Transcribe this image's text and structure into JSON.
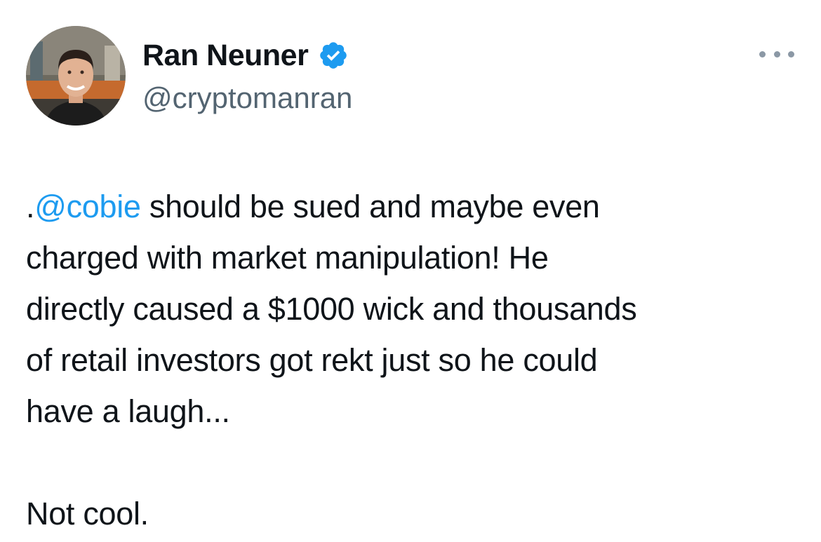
{
  "author": {
    "display_name": "Ran Neuner",
    "handle": "@cryptomanran",
    "verified_icon": "verified-badge-icon",
    "avatar": "profile-photo"
  },
  "menu": {
    "icon": "more-options-icon"
  },
  "tweet": {
    "prefix": ".",
    "mention": "@cobie",
    "line1_rest": " should be sued and maybe even",
    "line2": "charged with market manipulation! He",
    "line3": "directly caused a $1000 wick and thousands",
    "line4": "of retail investors got rekt just so he could",
    "line5": "have a laugh...",
    "closing": "Not cool."
  },
  "colors": {
    "link": "#1d9bf0",
    "verified": "#1d9bf0",
    "text": "#0f1419",
    "secondary": "#536471"
  }
}
